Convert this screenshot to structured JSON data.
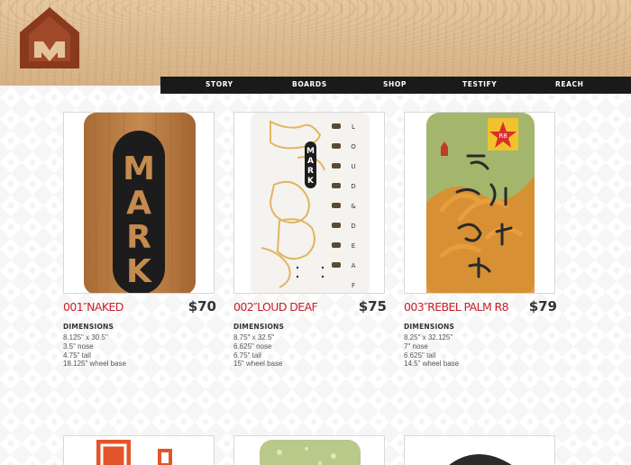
{
  "nav": {
    "items": [
      "STORY",
      "BOARDS",
      "SHOP",
      "TESTIFY",
      "REACH"
    ]
  },
  "colors": {
    "accent_red": "#c8202c",
    "nav_bg": "#1a1a1a",
    "logo_brown": "#8a3a1c"
  },
  "boards": [
    {
      "number": "001",
      "name": "NAKED",
      "price": "$70",
      "dimensions_label": "DIMENSIONS",
      "specs": [
        "8.125\" x 30.5\"",
        "3.5\" nose",
        "4.75\" tail",
        "18.125\" wheel base"
      ],
      "deck_text": "MARK"
    },
    {
      "number": "002",
      "name": "LOUD DEAF",
      "price": "$75",
      "dimensions_label": "DIMENSIONS",
      "specs": [
        "8.75\" x 32.5\"",
        "6.625\" nose",
        "6.75\" tail",
        "15\" wheel base"
      ],
      "deck_text": "MARK",
      "deck_side_text": "LOUD&DEAF"
    },
    {
      "number": "003",
      "name": "REBEL PALM R8",
      "price": "$79",
      "dimensions_label": "DIMENSIONS",
      "specs": [
        "8.25\" x 32.125\"",
        "7\" nose",
        "6.625\" tail",
        "14.5\" wheel base"
      ],
      "deck_badge": "R8"
    }
  ]
}
